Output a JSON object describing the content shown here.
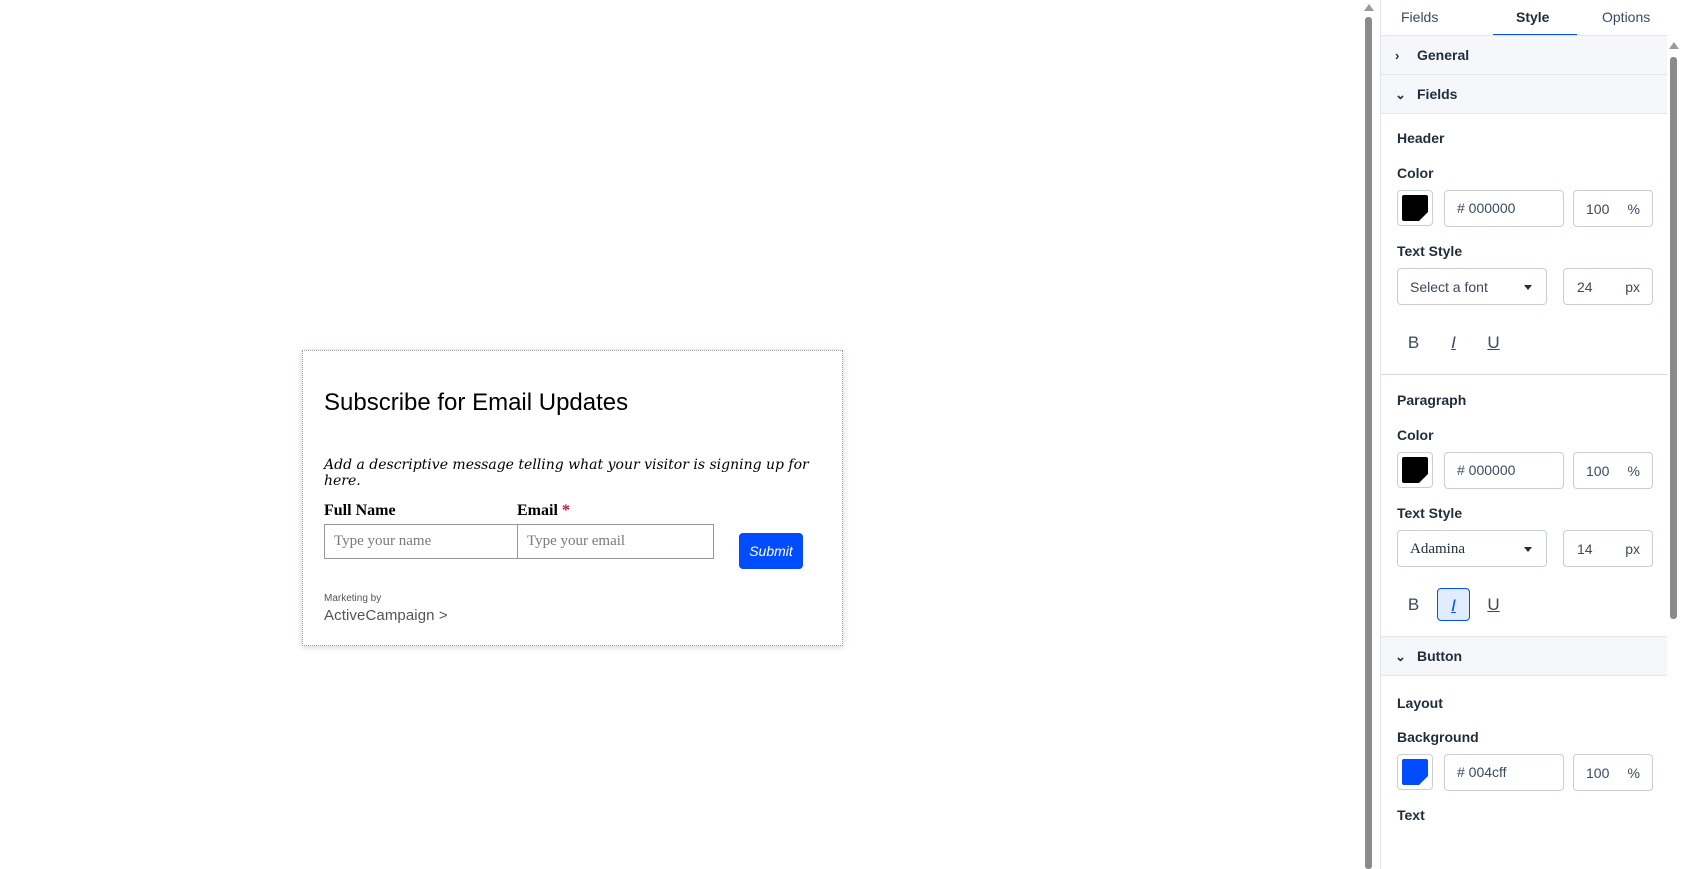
{
  "form": {
    "title": "Subscribe for Email Updates",
    "description": "Add a descriptive message telling what your visitor is signing up for here.",
    "full_name_label": "Full Name",
    "full_name_placeholder": "Type your name",
    "email_label": "Email",
    "required_mark": "*",
    "email_placeholder": "Type your email",
    "submit_label": "Submit",
    "marketing_by": "Marketing by",
    "brand": "ActiveCampaign",
    "brand_arrow": ">"
  },
  "panel": {
    "tabs": [
      {
        "label": "Fields"
      },
      {
        "label": "Style"
      },
      {
        "label": "Options"
      }
    ],
    "accordions": {
      "general": {
        "label": "General",
        "chevron": "›"
      },
      "fields": {
        "label": "Fields",
        "chevron": "⌄"
      },
      "button": {
        "label": "Button",
        "chevron": "⌄"
      }
    },
    "header": {
      "title": "Header",
      "color_label": "Color",
      "color_hex": "# 000000",
      "color_value": "#000000",
      "opacity": "100",
      "opacity_unit": "%",
      "text_style_label": "Text Style",
      "font": "Select a font",
      "size": "24",
      "size_unit": "px",
      "bold": "B",
      "italic": "I",
      "underline": "U"
    },
    "paragraph": {
      "title": "Paragraph",
      "color_label": "Color",
      "color_hex": "# 000000",
      "color_value": "#000000",
      "opacity": "100",
      "opacity_unit": "%",
      "text_style_label": "Text Style",
      "font": "Adamina",
      "size": "14",
      "size_unit": "px",
      "bold": "B",
      "italic": "I",
      "underline": "U"
    },
    "button": {
      "layout_label": "Layout",
      "background_label": "Background",
      "color_hex": "# 004cff",
      "color_value": "#004cff",
      "opacity": "100",
      "opacity_unit": "%",
      "text_label": "Text"
    }
  },
  "colors": {
    "accent": "#004cff",
    "text": "#1f2d3d"
  }
}
